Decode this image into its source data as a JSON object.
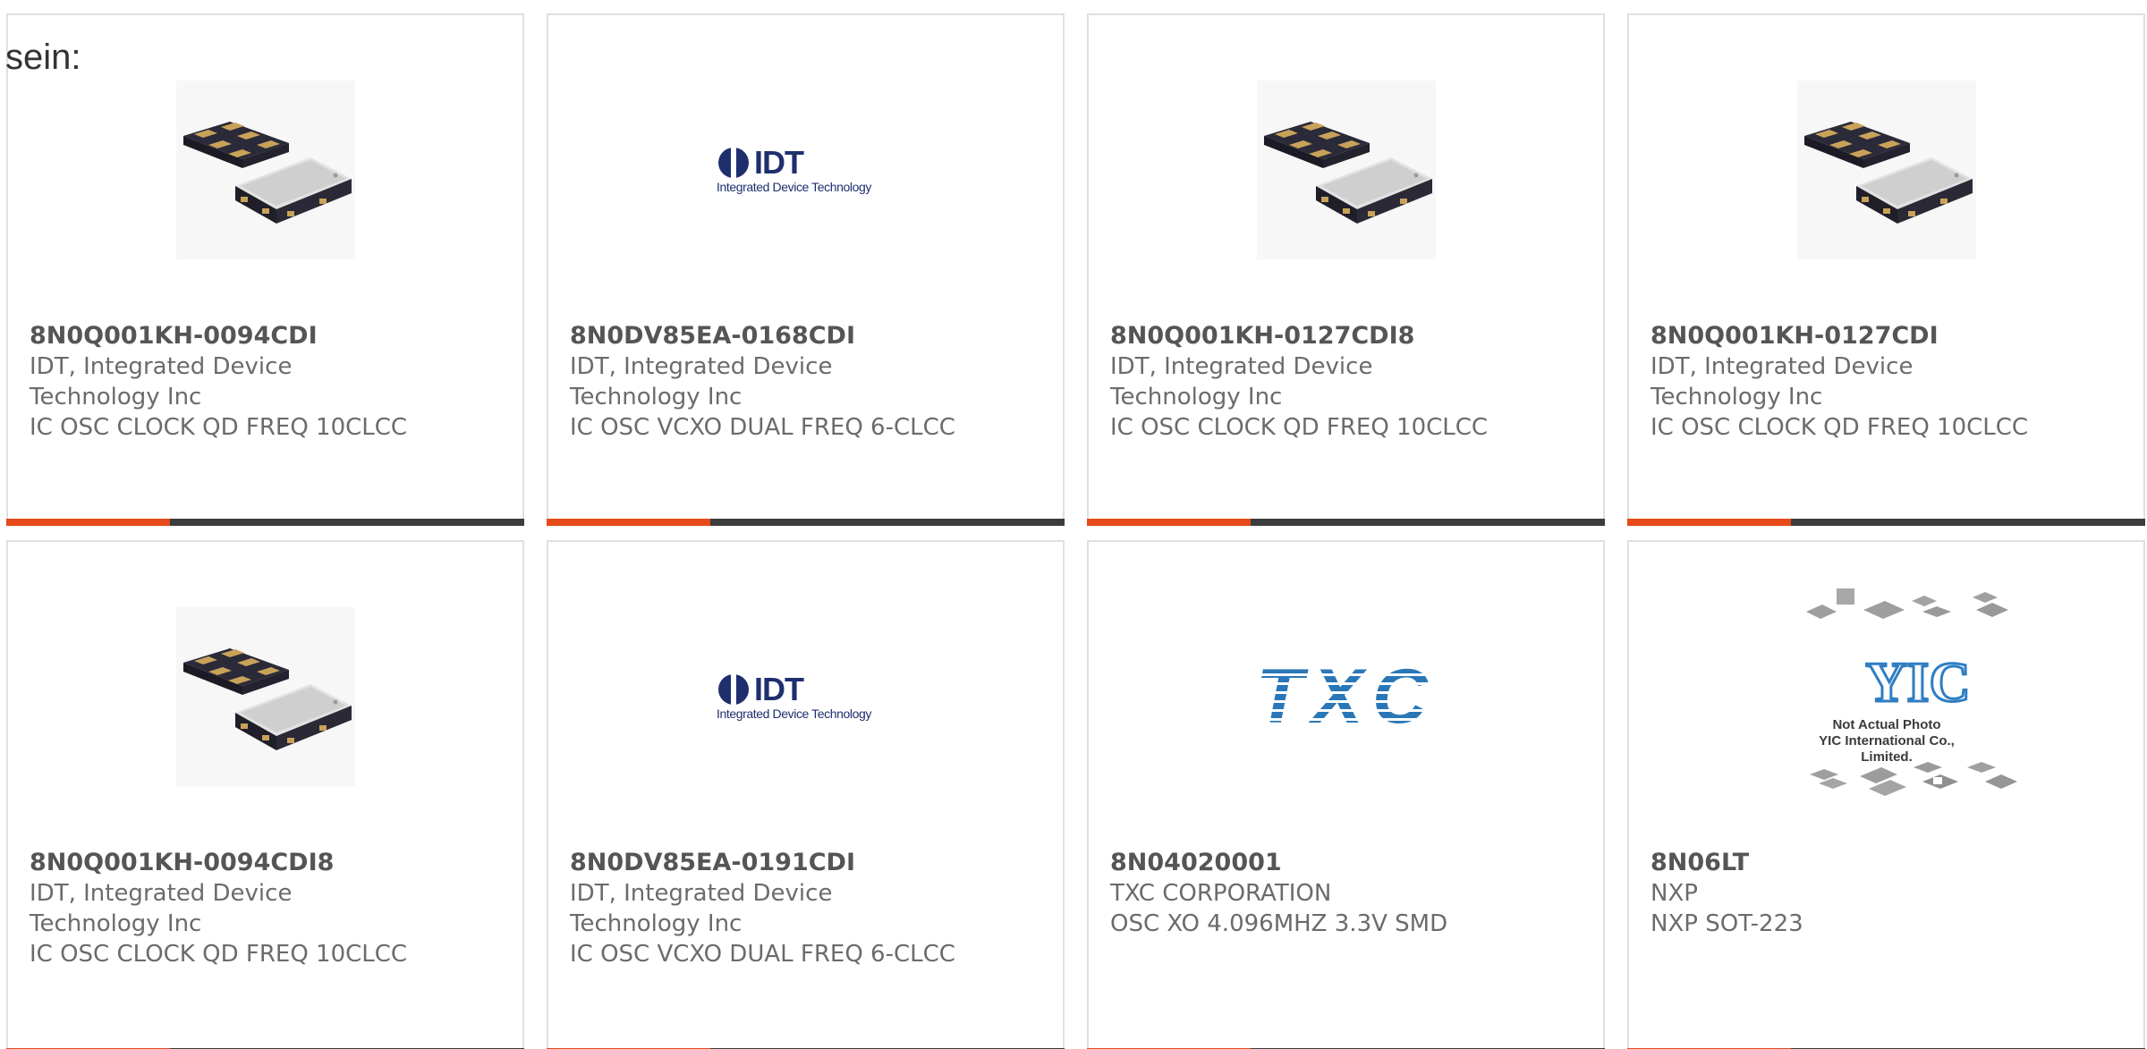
{
  "intro_text": "sein:",
  "colors": {
    "accent": "#e64a19",
    "bar": "#3c3c3c",
    "border": "#e0e0e0",
    "text": "#6b6b6b"
  },
  "logos": {
    "idt_word": "IDT",
    "idt_tagline": "Integrated Device Technology",
    "txc_word": "TXC",
    "yic_mark": "YIC",
    "yic_line1": "Not Actual Photo",
    "yic_line2": "YIC International Co., Limited."
  },
  "products": [
    {
      "part": "8N0Q001KH-0094CDI",
      "mfr_line1": "IDT, Integrated Device",
      "mfr_line2": "Technology Inc",
      "desc": "IC OSC CLOCK QD FREQ 10CLCC",
      "image": "oscillator-package-photo"
    },
    {
      "part": "8N0DV85EA-0168CDI",
      "mfr_line1": "IDT, Integrated Device",
      "mfr_line2": "Technology Inc",
      "desc": "IC OSC VCXO DUAL FREQ 6-CLCC",
      "image": "idt-logo"
    },
    {
      "part": "8N0Q001KH-0127CDI8",
      "mfr_line1": "IDT, Integrated Device",
      "mfr_line2": "Technology Inc",
      "desc": "IC OSC CLOCK QD FREQ 10CLCC",
      "image": "oscillator-package-photo"
    },
    {
      "part": "8N0Q001KH-0127CDI",
      "mfr_line1": "IDT, Integrated Device",
      "mfr_line2": "Technology Inc",
      "desc": "IC OSC CLOCK QD FREQ 10CLCC",
      "image": "oscillator-package-photo"
    },
    {
      "part": "8N0Q001KH-0094CDI8",
      "mfr_line1": "IDT, Integrated Device",
      "mfr_line2": "Technology Inc",
      "desc": "IC OSC CLOCK QD FREQ 10CLCC",
      "image": "oscillator-package-photo"
    },
    {
      "part": "8N0DV85EA-0191CDI",
      "mfr_line1": "IDT, Integrated Device",
      "mfr_line2": "Technology Inc",
      "desc": "IC OSC VCXO DUAL FREQ 6-CLCC",
      "image": "idt-logo"
    },
    {
      "part": "8N04020001",
      "mfr_line1": "TXC CORPORATION",
      "mfr_line2": "",
      "desc": "OSC XO 4.096MHZ 3.3V SMD",
      "image": "txc-logo"
    },
    {
      "part": "8N06LT",
      "mfr_line1": "NXP",
      "mfr_line2": "",
      "desc": "NXP SOT-223",
      "image": "yic-placeholder"
    }
  ]
}
